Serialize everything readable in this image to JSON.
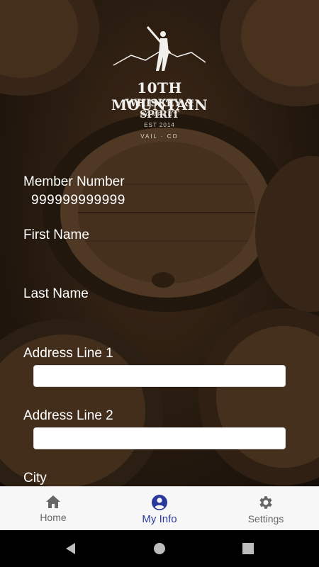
{
  "logo": {
    "title": "10TH MOUNTAIN",
    "subtitle": "WHISKEY & SPIRIT",
    "company": "COMPANY",
    "established": "EST 2014",
    "location": "VAIL · CO"
  },
  "form": {
    "member_number_label": "Member Number",
    "member_number_value": "999999999999",
    "first_name_label": "First Name",
    "last_name_label": "Last Name",
    "address1_label": "Address Line 1",
    "address1_value": "",
    "address2_label": "Address Line 2",
    "address2_value": "",
    "city_label": "City"
  },
  "tabs": {
    "home": "Home",
    "myinfo": "My Info",
    "settings": "Settings"
  },
  "colors": {
    "active_tab": "#2b3a9a",
    "inactive_tab": "#666666"
  }
}
